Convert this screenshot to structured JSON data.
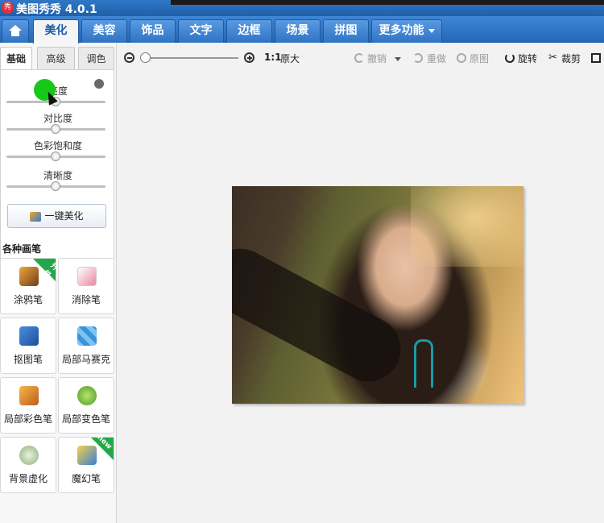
{
  "window": {
    "title": "美图秀秀 4.0.1",
    "logo_text": "秀"
  },
  "nav": {
    "tabs": [
      {
        "label": "美化"
      },
      {
        "label": "美容"
      },
      {
        "label": "饰品"
      },
      {
        "label": "文字"
      },
      {
        "label": "边框"
      },
      {
        "label": "场景"
      },
      {
        "label": "拼图"
      },
      {
        "label": "更多功能"
      }
    ],
    "active": "美化"
  },
  "left_panel": {
    "subtabs": [
      "基础",
      "高级",
      "调色"
    ],
    "active_subtab": "基础",
    "sliders": [
      {
        "label": "亮度",
        "value": 0.5
      },
      {
        "label": "对比度",
        "value": 0.5
      },
      {
        "label": "色彩饱和度",
        "value": 0.5
      },
      {
        "label": "清晰度",
        "value": 0.5
      }
    ],
    "one_key_label": "一键美化",
    "brush_section_title": "各种画笔",
    "tools": [
      {
        "label": "涂鸦笔",
        "badge": "升级",
        "icon": "brush-icon"
      },
      {
        "label": "消除笔",
        "badge": "",
        "icon": "eraser-icon"
      },
      {
        "label": "抠图笔",
        "badge": "",
        "icon": "cutout-pen-icon"
      },
      {
        "label": "局部马赛克",
        "badge": "",
        "icon": "mosaic-icon"
      },
      {
        "label": "局部彩色笔",
        "badge": "",
        "icon": "color-brush-icon"
      },
      {
        "label": "局部变色笔",
        "badge": "",
        "icon": "paint-bucket-icon"
      },
      {
        "label": "背景虚化",
        "badge": "",
        "icon": "blur-background-icon"
      },
      {
        "label": "魔幻笔",
        "badge": "new",
        "icon": "magic-pen-icon"
      }
    ]
  },
  "toolbar": {
    "zoom_value": 0.0,
    "actual_size_prefix": "1:1",
    "actual_size_label": "原大",
    "undo_label": "撤销",
    "redo_label": "重做",
    "original_label": "原图",
    "rotate_label": "旋转",
    "crop_label": "裁剪"
  },
  "colors": {
    "title_bar": "#2f78c7",
    "nav_bar": "#3f86d6",
    "active_tab_text": "#1e5aa5",
    "badge_green": "#22a84a",
    "cursor_highlight": "#18c818"
  }
}
